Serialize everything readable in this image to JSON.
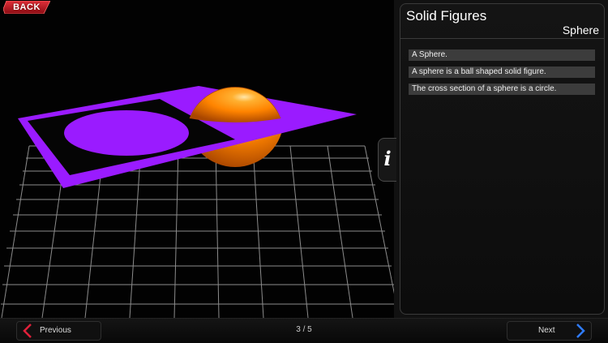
{
  "toolbar": {
    "back_label": "BACK"
  },
  "panel": {
    "title": "Solid Figures",
    "subtitle": "Sphere",
    "items": [
      "A Sphere.",
      "A sphere is a ball shaped solid figure.",
      "The cross section of a sphere is a circle."
    ],
    "info_tab_glyph": "i"
  },
  "navigation": {
    "previous_label": "Previous",
    "next_label": "Next",
    "page_indicator": "3 / 5"
  },
  "colors": {
    "plane": "#9a1bff",
    "sphere": "#ff8a00",
    "back_button": "#b5121b",
    "nav_chevron_left": "#e0203a",
    "nav_chevron_right": "#2f7cff",
    "grid": "#9a9a9a"
  },
  "icons": {
    "info": "info-icon",
    "previous": "chevron-left-icon",
    "next": "chevron-right-icon"
  }
}
